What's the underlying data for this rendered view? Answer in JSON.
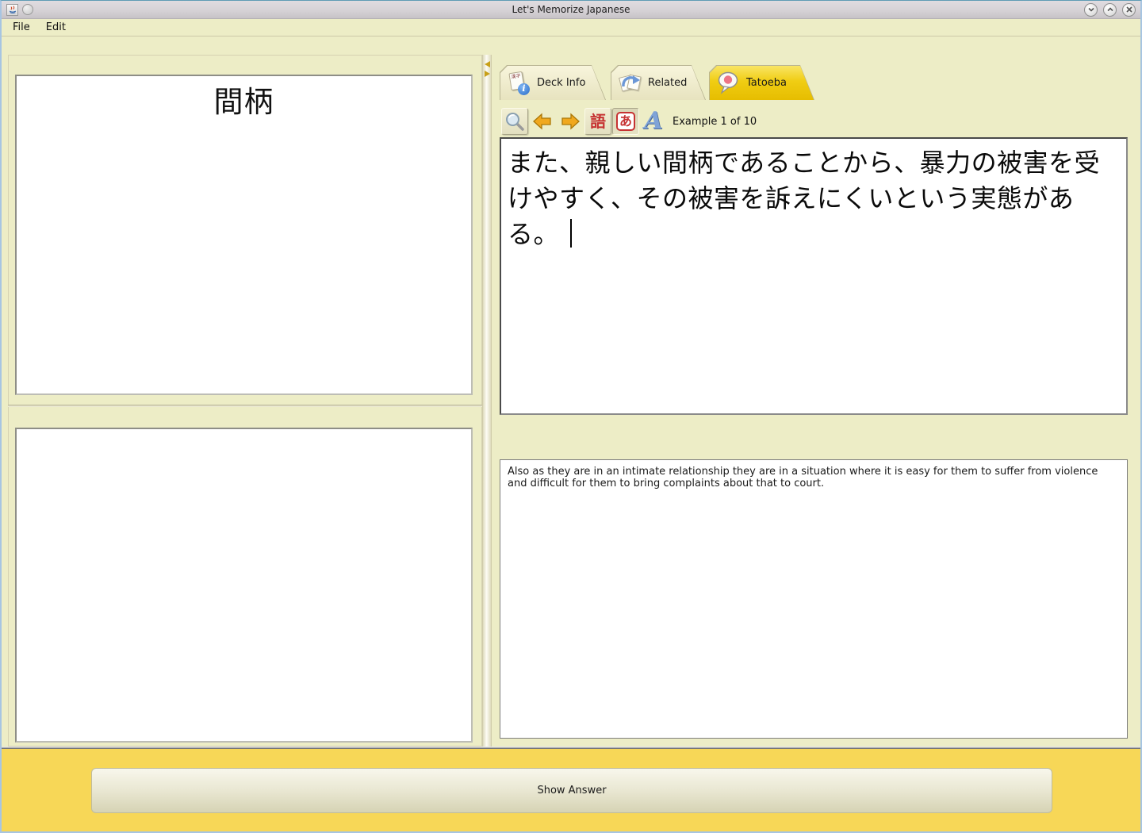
{
  "window": {
    "title": "Let's Memorize Japanese"
  },
  "menubar": {
    "items": [
      {
        "label": "File"
      },
      {
        "label": "Edit"
      }
    ]
  },
  "flashcard": {
    "front_text": "間柄"
  },
  "tabs": [
    {
      "label": "Deck Info",
      "icon": "kanji-card-info-icon",
      "icon_text": "漢字",
      "selected": false
    },
    {
      "label": "Related",
      "icon": "related-papers-arrow-icon",
      "selected": false
    },
    {
      "label": "Tatoeba",
      "icon": "speech-bubble-icon",
      "selected": true
    }
  ],
  "toolbar": {
    "word_button_glyph": "語",
    "kana_button_glyph": "あ",
    "font_button_glyph": "A",
    "status_text": "Example 1 of 10"
  },
  "example": {
    "japanese": "また、親しい間柄であることから、暴力の被害を受けやすく、その被害を訴えにくいという実態がある。",
    "english": "Also as they are in an intimate relationship they are in a situation where it is easy for them to suffer from violence and difficult for them to bring complaints about that to court."
  },
  "footer": {
    "show_answer_label": "Show Answer"
  },
  "colors": {
    "background": "#ededc6",
    "tab_selected": "#f0cd13",
    "footer_yellow": "#f7d757",
    "titlebar_grey": "#d6d2d6",
    "accent_red": "#c63232",
    "accent_blue": "#6b97d6",
    "window_border_blue": "#a7c5e2"
  }
}
